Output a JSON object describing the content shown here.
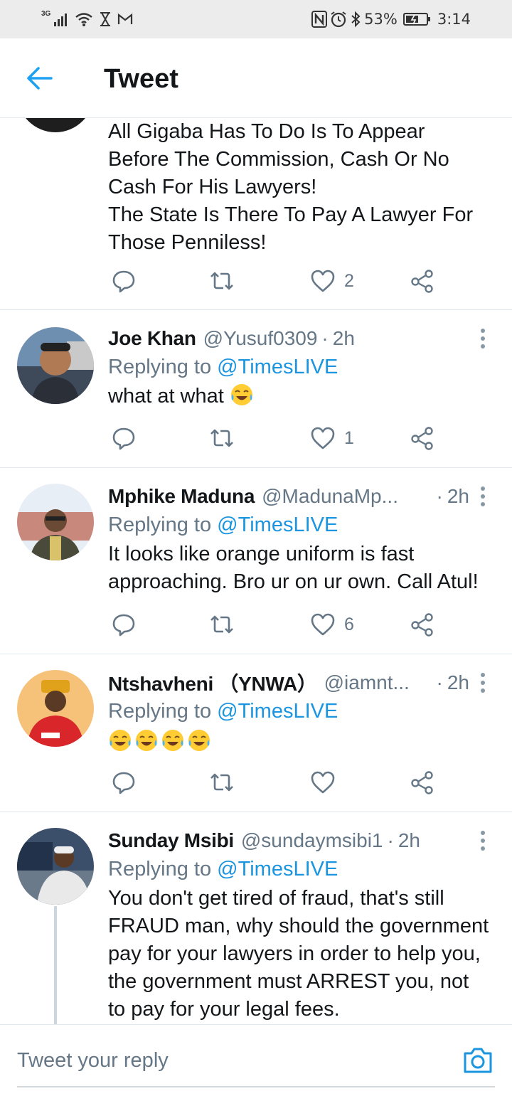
{
  "status_bar": {
    "network": "3G",
    "battery": "53%",
    "time": "3:14"
  },
  "header": {
    "title": "Tweet"
  },
  "tweets": [
    {
      "body": [
        "All Gigaba Has To Do Is To Appear",
        "Before The Commission, Cash Or No",
        "Cash For His Lawyers!",
        "The State Is There To Pay A Lawyer For",
        "Those Penniless!"
      ],
      "likes": "2"
    },
    {
      "name": "Joe Khan",
      "handle": "@Yusuf0309",
      "sep": "·",
      "time": "2h",
      "replying": "Replying to",
      "mention": "@TimesLIVE",
      "body": "what at what",
      "likes": "1"
    },
    {
      "name": "Mphike Maduna",
      "handle": "@MadunaMp...",
      "sep": "·",
      "time": "2h",
      "replying": "Replying to",
      "mention": "@TimesLIVE",
      "body": [
        "It looks like orange uniform is fast",
        "approaching. Bro ur on ur own. Call Atul!"
      ],
      "likes": "6"
    },
    {
      "name": "Ntshavheni （YNWA）",
      "handle": "@iamnt...",
      "sep": "·",
      "time": "2h",
      "replying": "Replying to",
      "mention": "@TimesLIVE",
      "likes": ""
    },
    {
      "name": "Sunday Msibi",
      "handle": "@sundaymsibi1",
      "sep": "·",
      "time": "2h",
      "replying": "Replying to",
      "mention": "@TimesLIVE",
      "body": [
        "You don't get tired of fraud, that's still",
        "FRAUD man, why should the government",
        "pay for your lawyers in order to help you,",
        "the government must ARREST you, not",
        "to pay for your legal fees."
      ]
    }
  ],
  "reply_bar": {
    "placeholder": "Tweet your reply"
  },
  "colors": {
    "accent": "#1b95e0",
    "secondary_text": "#657786",
    "divider": "#e1e8ed"
  }
}
